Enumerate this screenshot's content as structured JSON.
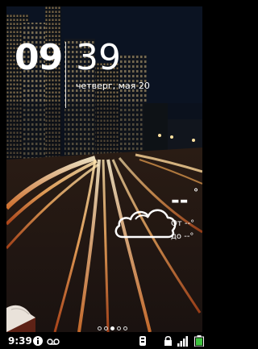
{
  "clock": {
    "hour": "09",
    "minute": "39",
    "date": "четверг, мая 20"
  },
  "weather": {
    "temperature": "--",
    "degree_symbol": "°",
    "low_label": "От --°",
    "high_label": "до --°",
    "icon": "cloud-icon"
  },
  "home": {
    "page_count": 5,
    "active_page": 2
  },
  "status_bar": {
    "time": "9:39",
    "icons": [
      "info-icon",
      "voicemail-icon",
      "usb-debug-icon",
      "lock-icon",
      "signal-icon",
      "battery-icon"
    ]
  },
  "colors": {
    "status_bar_bg": "#000000",
    "text": "#ffffff",
    "battery_fill": "#3fc43f"
  }
}
